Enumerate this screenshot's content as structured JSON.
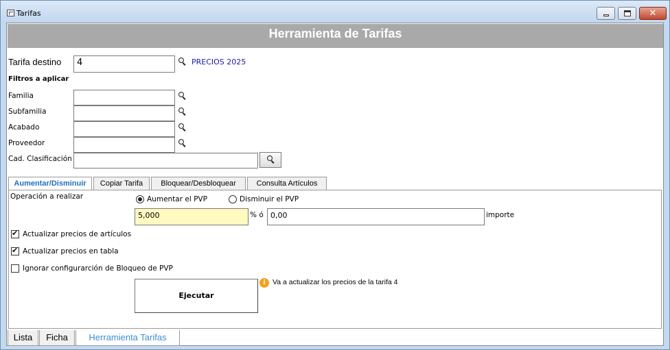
{
  "window": {
    "title": "Tarifas"
  },
  "banner": {
    "title": "Herramienta de Tarifas"
  },
  "tarifa": {
    "label": "Tarifa destino",
    "value": "4",
    "name": "PRECIOS 2025"
  },
  "filtros": {
    "heading": "Filtros a aplicar",
    "items": [
      {
        "label": "Familia",
        "value": ""
      },
      {
        "label": "Subfamilia",
        "value": ""
      },
      {
        "label": "Acabado",
        "value": ""
      },
      {
        "label": "Proveedor",
        "value": ""
      },
      {
        "label": "Cad. Clasificación",
        "value": ""
      }
    ]
  },
  "tabs": [
    "Aumentar/Disminuir",
    "Copiar Tarifa",
    "Bloquear/Desbloquear",
    "Consulta Artículos"
  ],
  "operacion": {
    "label": "Operación a realizar",
    "options": [
      "Aumentar el PVP",
      "Disminuir el PVP"
    ],
    "selected": "Aumentar el PVP",
    "percent_value": "5,000",
    "percent_sign": "% ó",
    "importe_value": "0,00",
    "importe_label": "importe"
  },
  "checks": [
    {
      "label": "Actualizar precios de artículos",
      "checked": true
    },
    {
      "label": "Actualizar precios en tabla",
      "checked": true
    },
    {
      "label": "Ignorar configurarción de Bloqueo de PVP",
      "checked": false
    }
  ],
  "ejecutar": {
    "label": "Ejecutar",
    "info": "Va a actualizar los precios de la tarifa 4"
  },
  "bottom_tabs": [
    "Lista",
    "Ficha",
    "Herramienta Tarifas"
  ],
  "colors": {
    "banner": "#a9a9a9",
    "highlight_field": "#fffac0",
    "active_tab": "#1f6fbf",
    "link": "#1a1aa6",
    "info": "#f2a21f"
  }
}
